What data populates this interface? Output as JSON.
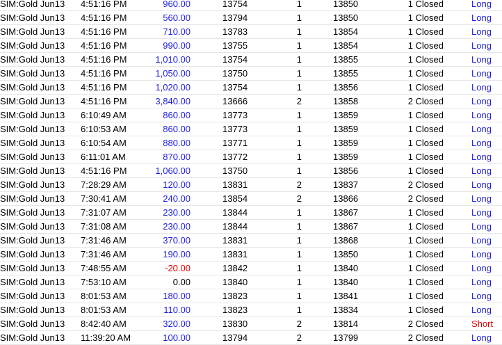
{
  "colors": {
    "positive": "#1f1fe0",
    "negative": "#e00000",
    "long": "#1f1fe0",
    "short": "#e00000"
  },
  "rows": [
    {
      "instrument": "SIM:Gold Jun13",
      "time": "4:51:16 PM",
      "pnl": "960.00",
      "pnl_sign": "pos",
      "entry": "13754",
      "qty": "1",
      "exit": "13850",
      "closed": "1 Closed",
      "side": "Long"
    },
    {
      "instrument": "SIM:Gold Jun13",
      "time": "4:51:16 PM",
      "pnl": "560.00",
      "pnl_sign": "pos",
      "entry": "13794",
      "qty": "1",
      "exit": "13850",
      "closed": "1 Closed",
      "side": "Long"
    },
    {
      "instrument": "SIM:Gold Jun13",
      "time": "4:51:16 PM",
      "pnl": "710.00",
      "pnl_sign": "pos",
      "entry": "13783",
      "qty": "1",
      "exit": "13854",
      "closed": "1 Closed",
      "side": "Long"
    },
    {
      "instrument": "SIM:Gold Jun13",
      "time": "4:51:16 PM",
      "pnl": "990.00",
      "pnl_sign": "pos",
      "entry": "13755",
      "qty": "1",
      "exit": "13854",
      "closed": "1 Closed",
      "side": "Long"
    },
    {
      "instrument": "SIM:Gold Jun13",
      "time": "4:51:16 PM",
      "pnl": "1,010.00",
      "pnl_sign": "pos",
      "entry": "13754",
      "qty": "1",
      "exit": "13855",
      "closed": "1 Closed",
      "side": "Long"
    },
    {
      "instrument": "SIM:Gold Jun13",
      "time": "4:51:16 PM",
      "pnl": "1,050.00",
      "pnl_sign": "pos",
      "entry": "13750",
      "qty": "1",
      "exit": "13855",
      "closed": "1 Closed",
      "side": "Long"
    },
    {
      "instrument": "SIM:Gold Jun13",
      "time": "4:51:16 PM",
      "pnl": "1,020.00",
      "pnl_sign": "pos",
      "entry": "13754",
      "qty": "1",
      "exit": "13856",
      "closed": "1 Closed",
      "side": "Long"
    },
    {
      "instrument": "SIM:Gold Jun13",
      "time": "4:51:16 PM",
      "pnl": "3,840.00",
      "pnl_sign": "pos",
      "entry": "13666",
      "qty": "2",
      "exit": "13858",
      "closed": "2 Closed",
      "side": "Long"
    },
    {
      "instrument": "SIM:Gold Jun13",
      "time": "6:10:49 AM",
      "pnl": "860.00",
      "pnl_sign": "pos",
      "entry": "13773",
      "qty": "1",
      "exit": "13859",
      "closed": "1 Closed",
      "side": "Long"
    },
    {
      "instrument": "SIM:Gold Jun13",
      "time": "6:10:53 AM",
      "pnl": "860.00",
      "pnl_sign": "pos",
      "entry": "13773",
      "qty": "1",
      "exit": "13859",
      "closed": "1 Closed",
      "side": "Long"
    },
    {
      "instrument": "SIM:Gold Jun13",
      "time": "6:10:54 AM",
      "pnl": "880.00",
      "pnl_sign": "pos",
      "entry": "13771",
      "qty": "1",
      "exit": "13859",
      "closed": "1 Closed",
      "side": "Long"
    },
    {
      "instrument": "SIM:Gold Jun13",
      "time": "6:11:01 AM",
      "pnl": "870.00",
      "pnl_sign": "pos",
      "entry": "13772",
      "qty": "1",
      "exit": "13859",
      "closed": "1 Closed",
      "side": "Long"
    },
    {
      "instrument": "SIM:Gold Jun13",
      "time": "4:51:16 PM",
      "pnl": "1,060.00",
      "pnl_sign": "pos",
      "entry": "13750",
      "qty": "1",
      "exit": "13856",
      "closed": "1 Closed",
      "side": "Long"
    },
    {
      "instrument": "SIM:Gold Jun13",
      "time": "7:28:29 AM",
      "pnl": "120.00",
      "pnl_sign": "pos",
      "entry": "13831",
      "qty": "2",
      "exit": "13837",
      "closed": "2 Closed",
      "side": "Long"
    },
    {
      "instrument": "SIM:Gold Jun13",
      "time": "7:30:41 AM",
      "pnl": "240.00",
      "pnl_sign": "pos",
      "entry": "13854",
      "qty": "2",
      "exit": "13866",
      "closed": "2 Closed",
      "side": "Long"
    },
    {
      "instrument": "SIM:Gold Jun13",
      "time": "7:31:07 AM",
      "pnl": "230.00",
      "pnl_sign": "pos",
      "entry": "13844",
      "qty": "1",
      "exit": "13867",
      "closed": "1 Closed",
      "side": "Long"
    },
    {
      "instrument": "SIM:Gold Jun13",
      "time": "7:31:08 AM",
      "pnl": "230.00",
      "pnl_sign": "pos",
      "entry": "13844",
      "qty": "1",
      "exit": "13867",
      "closed": "1 Closed",
      "side": "Long"
    },
    {
      "instrument": "SIM:Gold Jun13",
      "time": "7:31:46 AM",
      "pnl": "370.00",
      "pnl_sign": "pos",
      "entry": "13831",
      "qty": "1",
      "exit": "13868",
      "closed": "1 Closed",
      "side": "Long"
    },
    {
      "instrument": "SIM:Gold Jun13",
      "time": "7:31:46 AM",
      "pnl": "190.00",
      "pnl_sign": "pos",
      "entry": "13831",
      "qty": "1",
      "exit": "13850",
      "closed": "1 Closed",
      "side": "Long"
    },
    {
      "instrument": "SIM:Gold Jun13",
      "time": "7:48:55 AM",
      "pnl": "-20.00",
      "pnl_sign": "neg",
      "entry": "13842",
      "qty": "1",
      "exit": "13840",
      "closed": "1 Closed",
      "side": "Long"
    },
    {
      "instrument": "SIM:Gold Jun13",
      "time": "7:53:10 AM",
      "pnl": "0.00",
      "pnl_sign": "zero",
      "entry": "13840",
      "qty": "1",
      "exit": "13840",
      "closed": "1 Closed",
      "side": "Long"
    },
    {
      "instrument": "SIM:Gold Jun13",
      "time": "8:01:53 AM",
      "pnl": "180.00",
      "pnl_sign": "pos",
      "entry": "13823",
      "qty": "1",
      "exit": "13841",
      "closed": "1 Closed",
      "side": "Long"
    },
    {
      "instrument": "SIM:Gold Jun13",
      "time": "8:01:53 AM",
      "pnl": "110.00",
      "pnl_sign": "pos",
      "entry": "13823",
      "qty": "1",
      "exit": "13834",
      "closed": "1 Closed",
      "side": "Long"
    },
    {
      "instrument": "SIM:Gold Jun13",
      "time": "8:42:40 AM",
      "pnl": "320.00",
      "pnl_sign": "pos",
      "entry": "13830",
      "qty": "2",
      "exit": "13814",
      "closed": "2 Closed",
      "side": "Short"
    },
    {
      "instrument": "SIM:Gold Jun13",
      "time": "11:39:20 AM",
      "pnl": "100.00",
      "pnl_sign": "pos",
      "entry": "13794",
      "qty": "2",
      "exit": "13799",
      "closed": "2 Closed",
      "side": "Long"
    }
  ]
}
